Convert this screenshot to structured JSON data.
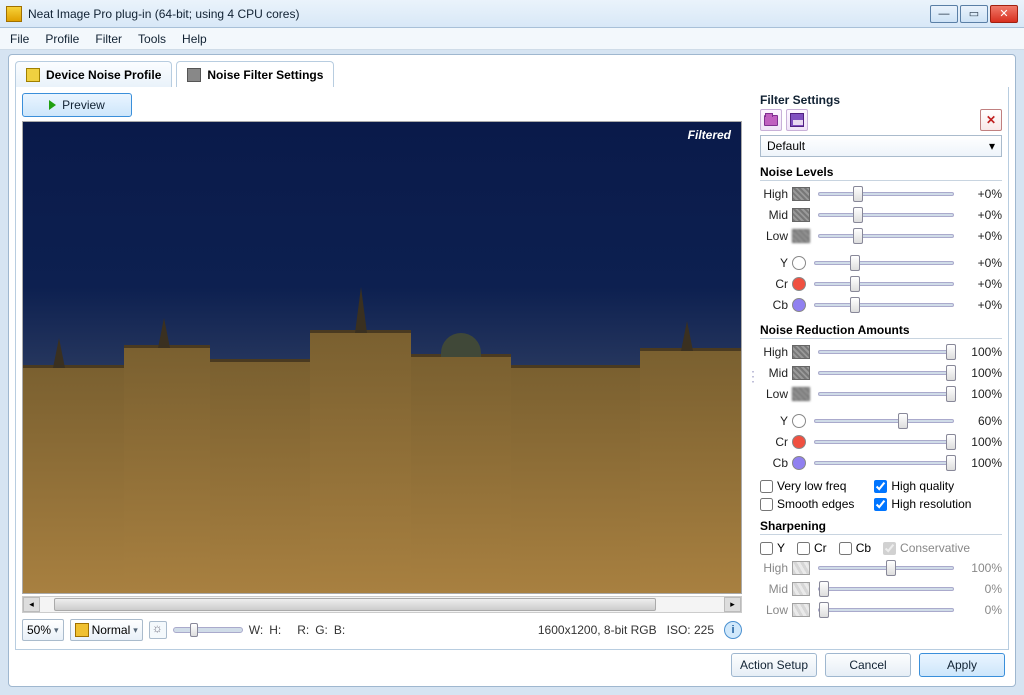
{
  "window": {
    "title": "Neat Image Pro plug-in (64-bit; using 4 CPU cores)"
  },
  "menu": {
    "file": "File",
    "profile": "Profile",
    "filter": "Filter",
    "tools": "Tools",
    "help": "Help"
  },
  "tabs": {
    "deviceProfile": "Device Noise Profile",
    "filterSettings": "Noise Filter Settings"
  },
  "preview": {
    "button": "Preview",
    "badge": "Filtered"
  },
  "status": {
    "zoom": "50%",
    "viewMode": "Normal",
    "w": "W:",
    "h": "H:",
    "r": "R:",
    "g": "G:",
    "b": "B:",
    "imageInfo": "1600x1200, 8-bit RGB",
    "iso": "ISO: 225"
  },
  "panel": {
    "title": "Filter Settings",
    "preset": "Default",
    "noiseLevels": {
      "title": "Noise Levels",
      "rows": [
        {
          "label": "High",
          "value": "+0%",
          "pos": 25
        },
        {
          "label": "Mid",
          "value": "+0%",
          "pos": 25
        },
        {
          "label": "Low",
          "value": "+0%",
          "pos": 25
        },
        {
          "label": "Y",
          "value": "+0%",
          "pos": 25
        },
        {
          "label": "Cr",
          "value": "+0%",
          "pos": 25
        },
        {
          "label": "Cb",
          "value": "+0%",
          "pos": 25
        }
      ]
    },
    "reduction": {
      "title": "Noise Reduction Amounts",
      "rows": [
        {
          "label": "High",
          "value": "100%",
          "pos": 95
        },
        {
          "label": "Mid",
          "value": "100%",
          "pos": 95
        },
        {
          "label": "Low",
          "value": "100%",
          "pos": 95
        },
        {
          "label": "Y",
          "value": "60%",
          "pos": 60
        },
        {
          "label": "Cr",
          "value": "100%",
          "pos": 95
        },
        {
          "label": "Cb",
          "value": "100%",
          "pos": 95
        }
      ]
    },
    "checks": {
      "veryLowFreq": "Very low freq",
      "smoothEdges": "Smooth edges",
      "highQuality": "High quality",
      "highResolution": "High resolution"
    },
    "sharpening": {
      "title": "Sharpening",
      "channels": {
        "y": "Y",
        "cr": "Cr",
        "cb": "Cb",
        "conservative": "Conservative"
      },
      "rows": [
        {
          "label": "High",
          "value": "100%",
          "pos": 50
        },
        {
          "label": "Mid",
          "value": "0%",
          "pos": 0
        },
        {
          "label": "Low",
          "value": "0%",
          "pos": 0
        }
      ]
    }
  },
  "footer": {
    "actionSetup": "Action Setup",
    "cancel": "Cancel",
    "apply": "Apply"
  }
}
